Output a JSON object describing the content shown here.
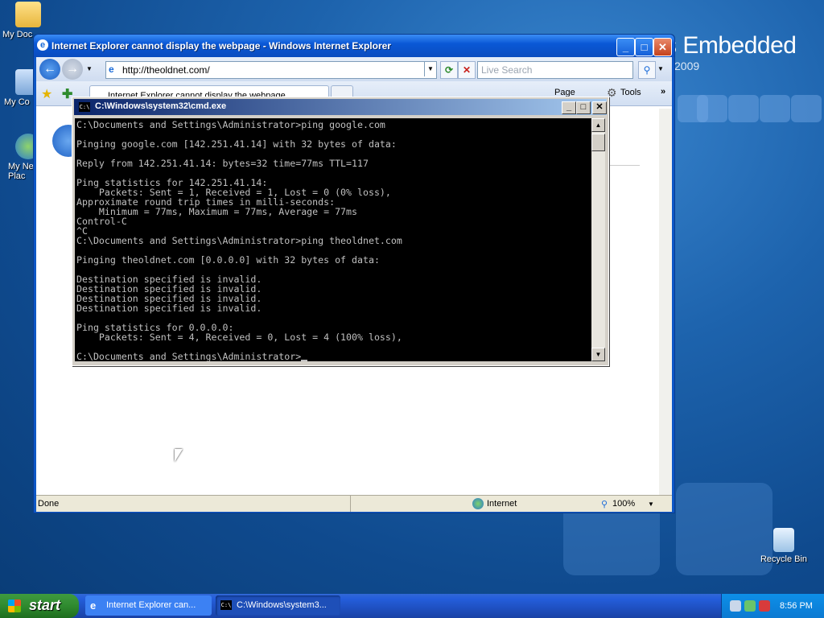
{
  "desktop": {
    "brand": "s Embedded",
    "brand_year": "2009",
    "icons": [
      {
        "label": "My Doc"
      },
      {
        "label": "My Co"
      },
      {
        "label": "My Ne Plac"
      },
      {
        "label": "Recycle Bin"
      }
    ]
  },
  "ie": {
    "title": "Internet Explorer cannot display the webpage - Windows Internet Explorer",
    "address": "http://theoldnet.com/",
    "search_placeholder": "Live Search",
    "tab_label": "Internet Explorer cannot display the webpage",
    "page_btn": "Page",
    "tools_btn": "Tools",
    "status_text": "Done",
    "zone": "Internet",
    "zoom": "100%"
  },
  "cmd": {
    "title": "C:\\Windows\\system32\\cmd.exe",
    "icon_text": "C:\\",
    "lines": [
      "C:\\Documents and Settings\\Administrator>ping google.com",
      "",
      "Pinging google.com [142.251.41.14] with 32 bytes of data:",
      "",
      "Reply from 142.251.41.14: bytes=32 time=77ms TTL=117",
      "",
      "Ping statistics for 142.251.41.14:",
      "    Packets: Sent = 1, Received = 1, Lost = 0 (0% loss),",
      "Approximate round trip times in milli-seconds:",
      "    Minimum = 77ms, Maximum = 77ms, Average = 77ms",
      "Control-C",
      "^C",
      "C:\\Documents and Settings\\Administrator>ping theoldnet.com",
      "",
      "Pinging theoldnet.com [0.0.0.0] with 32 bytes of data:",
      "",
      "Destination specified is invalid.",
      "Destination specified is invalid.",
      "Destination specified is invalid.",
      "Destination specified is invalid.",
      "",
      "Ping statistics for 0.0.0.0:",
      "    Packets: Sent = 4, Received = 0, Lost = 4 (100% loss),",
      ""
    ],
    "prompt": "C:\\Documents and Settings\\Administrator>"
  },
  "taskbar": {
    "start_label": "start",
    "tasks": [
      {
        "label": "Internet Explorer can..."
      },
      {
        "label": "C:\\Windows\\system3..."
      }
    ],
    "clock": "8:56 PM"
  }
}
